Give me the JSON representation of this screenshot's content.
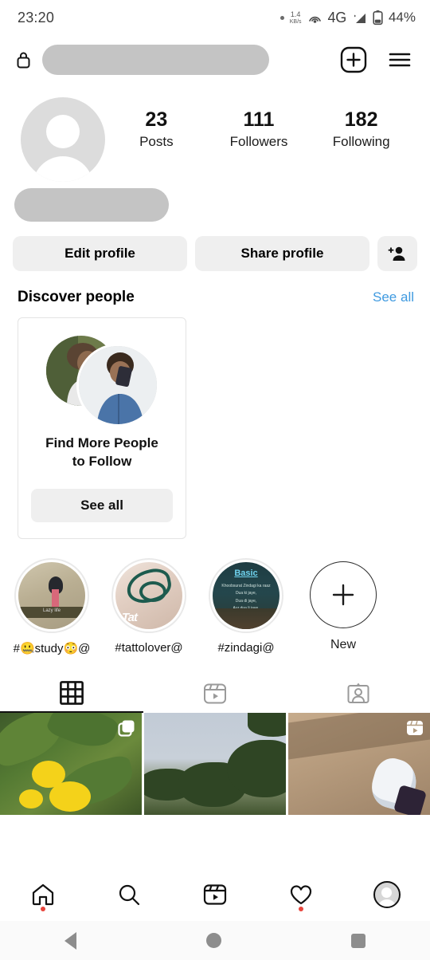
{
  "status_bar": {
    "time": "23:20",
    "net_speed_value": "1.4",
    "net_speed_unit": "KB/s",
    "network_type": "4G",
    "battery_percent": "44%",
    "icons": [
      "dot-indicator-icon",
      "hotspot-icon",
      "signal-bars-icon",
      "battery-icon"
    ]
  },
  "header": {
    "lock_icon": "lock-icon",
    "username_redacted": "",
    "add_icon": "plus-square-icon",
    "menu_icon": "hamburger-menu-icon"
  },
  "profile": {
    "avatar_icon": "default-avatar-icon",
    "display_name_redacted": "",
    "stats": [
      {
        "count": "23",
        "label": "Posts"
      },
      {
        "count": "111",
        "label": "Followers"
      },
      {
        "count": "182",
        "label": "Following"
      }
    ]
  },
  "actions": {
    "edit_profile": "Edit profile",
    "share_profile": "Share profile",
    "add_person_icon": "add-person-icon"
  },
  "discover": {
    "title": "Discover people",
    "see_all_link": "See all",
    "see_all_color": "#3f9ae0",
    "card": {
      "title_line1": "Find More People",
      "title_line2": "to Follow",
      "button_label": "See all"
    }
  },
  "highlights": {
    "items": [
      {
        "label": "#🤐study😳@",
        "art": "study"
      },
      {
        "label": "#tattolover@",
        "art": "tattoo"
      },
      {
        "label": "#zindagi@",
        "art": "zindagi"
      }
    ],
    "new_label": "New",
    "new_icon": "plus-icon"
  },
  "tabs": [
    {
      "name": "grid",
      "icon": "grid-icon",
      "active": true
    },
    {
      "name": "reels",
      "icon": "reels-icon",
      "active": false
    },
    {
      "name": "tagged",
      "icon": "tagged-person-icon",
      "active": false
    }
  ],
  "posts": [
    {
      "description": "yellow flowers on green leaves",
      "badge": "carousel-icon"
    },
    {
      "description": "trees against pale sky",
      "badge": ""
    },
    {
      "description": "white sneaker on dirt path",
      "badge": "reels-icon"
    }
  ],
  "bottom_nav": [
    {
      "name": "home",
      "icon": "home-icon",
      "badge": true
    },
    {
      "name": "search",
      "icon": "search-icon",
      "badge": false
    },
    {
      "name": "reels",
      "icon": "reels-icon",
      "badge": false
    },
    {
      "name": "activity",
      "icon": "heart-icon",
      "badge": true
    },
    {
      "name": "profile",
      "icon": "profile-avatar-icon",
      "badge": false
    }
  ],
  "android_nav": {
    "back": "back-triangle-icon",
    "home": "home-circle-icon",
    "recents": "recents-square-icon"
  },
  "colors": {
    "accent_blue": "#3f9ae0",
    "badge_red": "#e8453c",
    "button_grey": "#efefef"
  }
}
